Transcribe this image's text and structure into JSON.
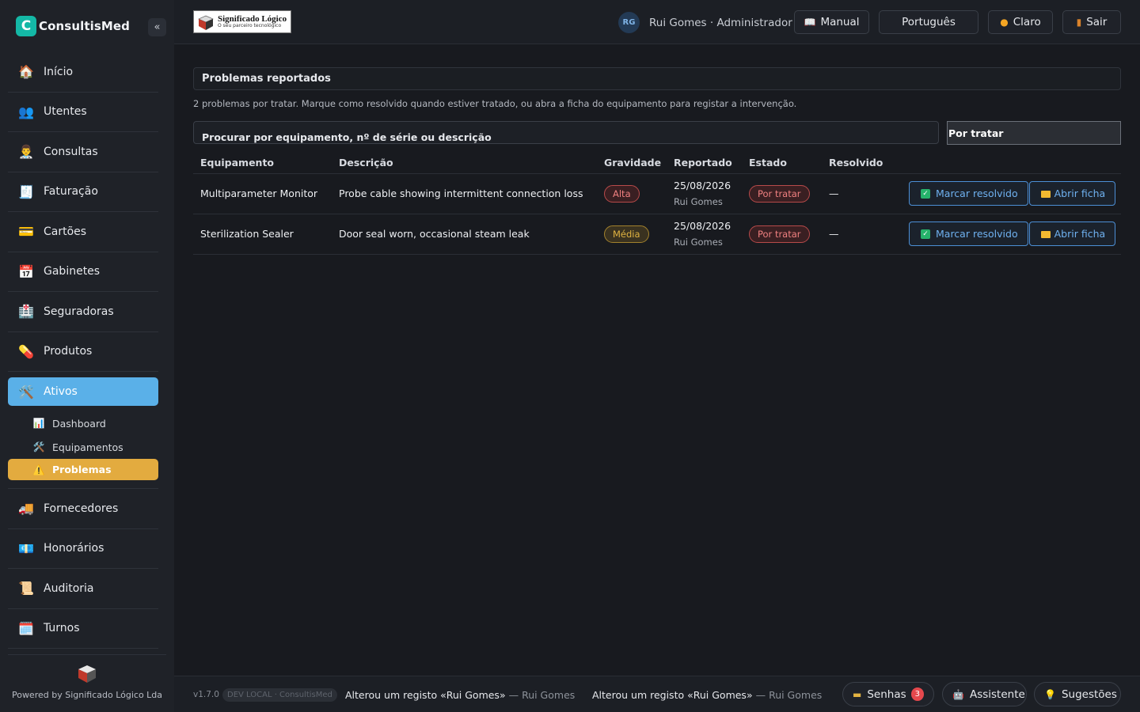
{
  "app": {
    "name": "ConsultisMed",
    "logo_letter": "C",
    "collapse_glyph": "«"
  },
  "sidebar": {
    "items": [
      {
        "label": "Início",
        "icon": "house-icon",
        "glyph": "🏠"
      },
      {
        "label": "Utentes",
        "icon": "people-icon",
        "glyph": "👥"
      },
      {
        "label": "Consultas",
        "icon": "doctor-icon",
        "glyph": "👨‍⚕️"
      },
      {
        "label": "Faturação",
        "icon": "receipt-icon",
        "glyph": "🧾"
      },
      {
        "label": "Cartões",
        "icon": "card-icon",
        "glyph": "💳"
      },
      {
        "label": "Gabinetes",
        "icon": "calendar-icon",
        "glyph": "📅"
      },
      {
        "label": "Seguradoras",
        "icon": "insurance-icon",
        "glyph": "🏥"
      },
      {
        "label": "Produtos",
        "icon": "pill-icon",
        "glyph": "💊"
      },
      {
        "label": "Ativos",
        "icon": "tools-icon",
        "glyph": "🛠️"
      },
      {
        "label": "Fornecedores",
        "icon": "truck-icon",
        "glyph": "🚚"
      },
      {
        "label": "Honorários",
        "icon": "money-icon",
        "glyph": "💶"
      },
      {
        "label": "Auditoria",
        "icon": "scroll-icon",
        "glyph": "📜"
      },
      {
        "label": "Turnos",
        "icon": "calendar-icon",
        "glyph": "🗓️"
      }
    ],
    "subitems": [
      {
        "label": "Dashboard",
        "icon": "bar-chart-icon",
        "glyph": "📊"
      },
      {
        "label": "Equipamentos",
        "icon": "tools-icon",
        "glyph": "🛠️"
      },
      {
        "label": "Problemas",
        "icon": "warning-icon",
        "glyph": "⚠️"
      }
    ],
    "powered_by": "Powered by Significado Lógico Lda"
  },
  "header": {
    "client_logo_title": "Significado Lógico",
    "client_logo_subtitle": "O seu parceiro tecnológico",
    "user_initials": "RG",
    "user_label": "Rui Gomes · Administrador",
    "manual_label": "Manual",
    "language_label": "Português",
    "theme_label": "Claro",
    "logout_label": "Sair"
  },
  "main": {
    "title": "Problemas reportados",
    "info": "2 problemas por tratar. Marque como resolvido quando estiver tratado, ou abra a ficha do equipamento para registar a intervenção.",
    "search_placeholder": "Procurar por equipamento, nº de série ou descrição",
    "filter_value": "Por tratar",
    "columns": [
      "Equipamento",
      "Descrição",
      "Gravidade",
      "Reportado",
      "Estado",
      "Resolvido"
    ],
    "rows": [
      {
        "equipment": "Multiparameter Monitor",
        "description": "Probe cable showing intermittent connection loss",
        "severity": "Alta",
        "date": "25/08/2026",
        "reporter": "Rui Gomes",
        "status": "Por tratar",
        "resolved": "—"
      },
      {
        "equipment": "Sterilization Sealer",
        "description": "Door seal worn, occasional steam leak",
        "severity": "Média",
        "date": "25/08/2026",
        "reporter": "Rui Gomes",
        "status": "Por tratar",
        "resolved": "—"
      }
    ],
    "mark_resolved_label": "Marcar resolvido",
    "open_record_label": "Abrir ficha"
  },
  "footer": {
    "version": "v1.7.0",
    "env": "DEV LOCAL · ConsultisMed",
    "log1_action": "Alterou um registo «Rui Gomes»",
    "log1_who": "— Rui Gomes",
    "log2_action": "Alterou um registo «Rui Gomes»",
    "log2_who": "— Rui Gomes",
    "tickets_label": "Senhas",
    "tickets_count": "3",
    "assistant_label": "Assistente",
    "suggestions_label": "Sugestões"
  },
  "colors": {
    "accent": "#5ab0e8",
    "active_sub": "#e3ab3f",
    "danger": "#e5484d",
    "brand": "#14b8a6"
  }
}
